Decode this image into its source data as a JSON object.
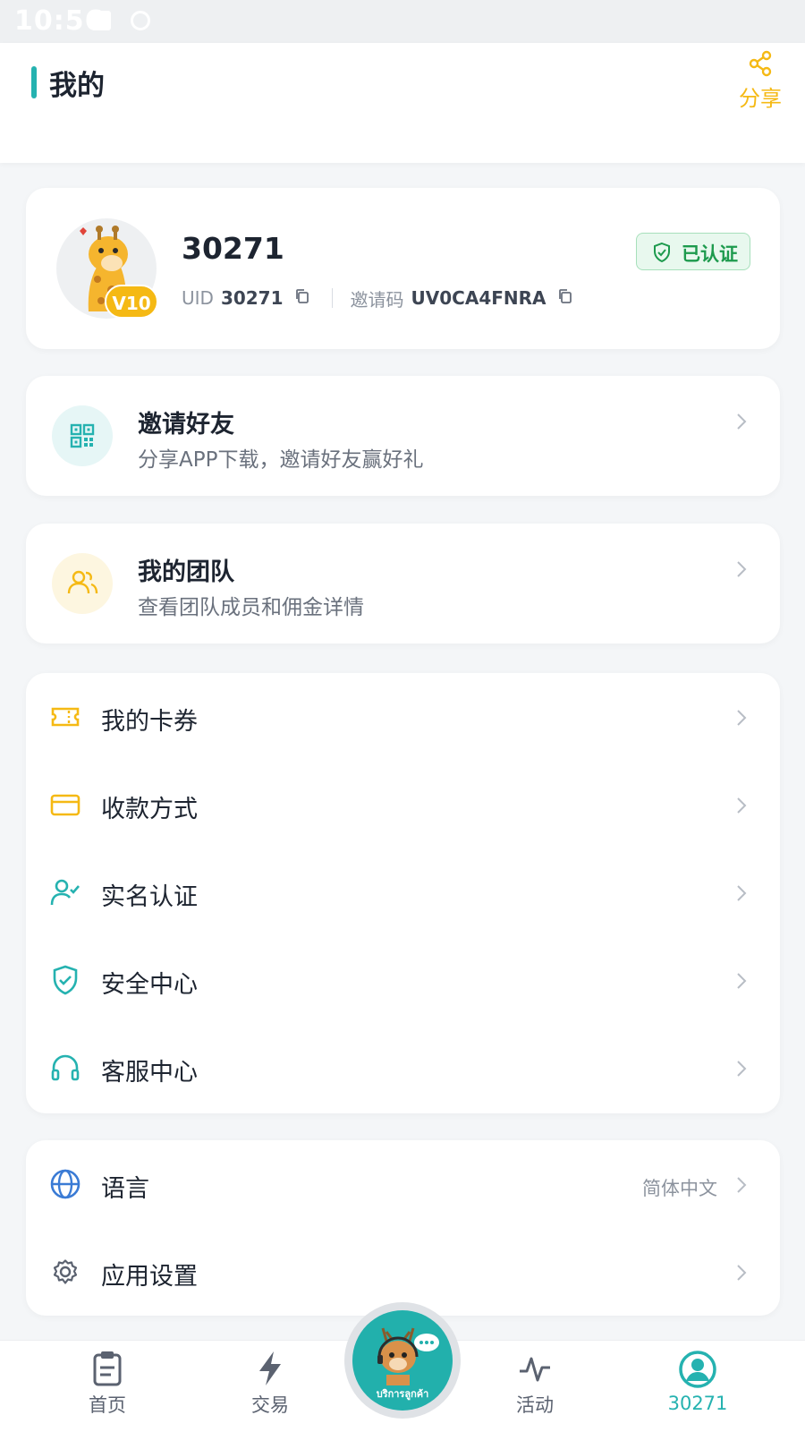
{
  "status_bar": {
    "time": "10:56"
  },
  "header": {
    "title": "我的",
    "share_label": "分享"
  },
  "profile": {
    "username": "30271",
    "vip_level": "V10",
    "verified_label": "已认证",
    "uid_label": "UID",
    "uid_value": "30271",
    "invite_label": "邀请码",
    "invite_code": "UV0CA4FNRA"
  },
  "invite_card": {
    "title": "邀请好友",
    "subtitle": "分享APP下载，邀请好友赢好礼"
  },
  "team_card": {
    "title": "我的团队",
    "subtitle": "查看团队成员和佣金详情"
  },
  "menu": {
    "items": [
      {
        "label": "我的卡券",
        "icon": "ticket-icon"
      },
      {
        "label": "收款方式",
        "icon": "card-icon"
      },
      {
        "label": "实名认证",
        "icon": "user-check-icon"
      },
      {
        "label": "安全中心",
        "icon": "shield-icon"
      },
      {
        "label": "客服中心",
        "icon": "headset-icon"
      }
    ]
  },
  "settings": {
    "language_label": "语言",
    "language_value": "简体中文",
    "app_settings_label": "应用设置"
  },
  "bottom_nav": {
    "items": [
      {
        "label": "首页"
      },
      {
        "label": "交易"
      },
      {
        "label": "活动"
      },
      {
        "label": "30271"
      }
    ],
    "center_label": "บริการลูกค้า"
  },
  "colors": {
    "accent_teal": "#25b2b0",
    "accent_yellow": "#f5b914",
    "verified_green": "#1d9a4d",
    "background": "#f4f6f8"
  }
}
